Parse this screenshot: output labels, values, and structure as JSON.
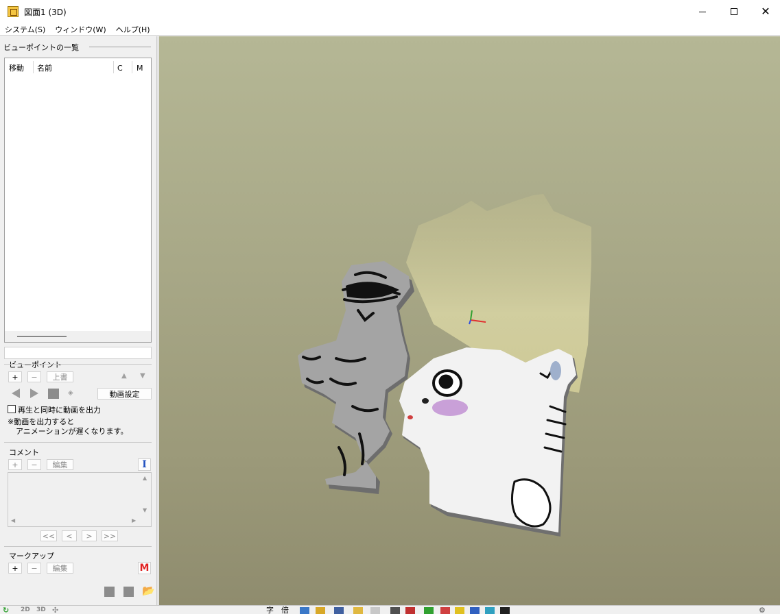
{
  "window": {
    "title": "図面1 (3D)"
  },
  "menu": [
    "システム(S)",
    "ウィンドウ(W)",
    "ヘルプ(H)"
  ],
  "viewpoint_list": {
    "title": "ビューポイントの一覧",
    "columns": [
      "移動",
      "名前",
      "C",
      "M"
    ]
  },
  "viewpoint": {
    "title": "ビューポイント",
    "add": "+",
    "remove": "−",
    "overwrite": "上書",
    "animation_settings": "動画設定",
    "export_checkbox": "再生と同時に動画を出力",
    "note_line1": "※動画を出力すると",
    "note_line2": "アニメーションが遅くなります。"
  },
  "comment": {
    "title": "コメント",
    "add": "+",
    "remove": "−",
    "edit": "編集",
    "text_tool": "I",
    "nav": [
      "<<",
      "<",
      ">",
      ">>"
    ]
  },
  "markup": {
    "title": "マークアップ",
    "add": "+",
    "remove": "−",
    "edit": "編集",
    "marker": "M"
  },
  "statusbar": {
    "mode_2d": "2D",
    "mode_3d": "3D",
    "char_tool": "字",
    "scale_tool": "倍"
  },
  "colors": {
    "viewport_top": "#b5b795",
    "viewport_bottom": "#8f8c6e",
    "marker_red": "#e02020",
    "text_tool_blue": "#2050c0"
  }
}
